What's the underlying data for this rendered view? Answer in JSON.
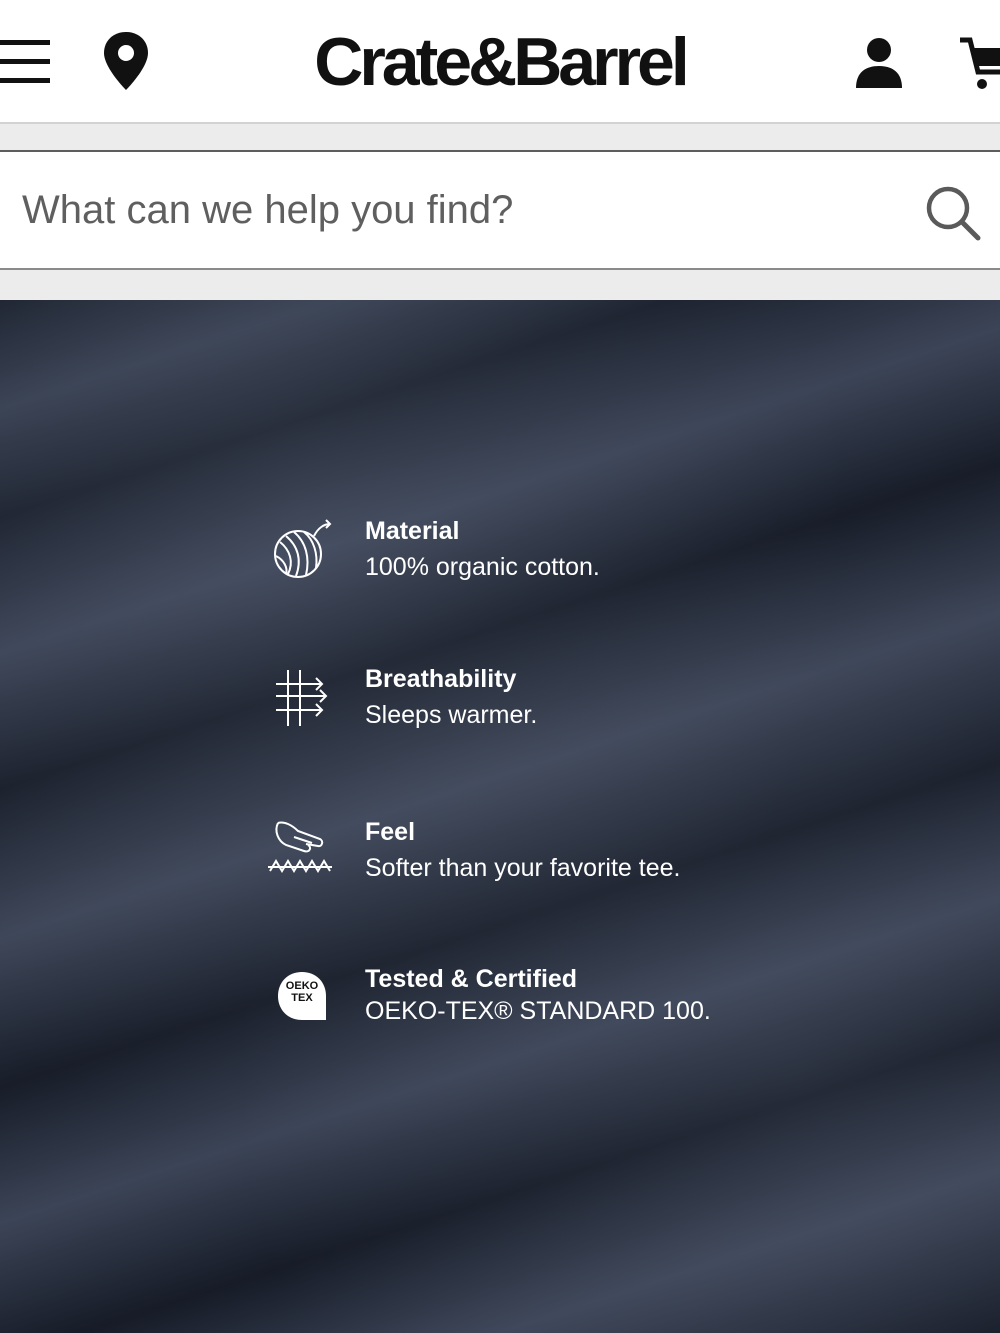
{
  "header": {
    "brand": "Crate&Barrel",
    "icons": [
      "menu-icon",
      "location-pin-icon",
      "account-icon",
      "cart-icon"
    ]
  },
  "search": {
    "placeholder": "What can we help you find?",
    "icon": "search-icon"
  },
  "features": [
    {
      "icon": "cotton-ball-icon",
      "title": "Material",
      "description": "100% organic cotton."
    },
    {
      "icon": "breathability-arrows-icon",
      "title": "Breathability",
      "description": "Sleeps warmer."
    },
    {
      "icon": "hand-feel-icon",
      "title": "Feel",
      "description": "Softer than your favorite tee."
    },
    {
      "icon": "oeko-tex-icon",
      "badge": "OEKO\nTEX",
      "title": "Tested & Certified",
      "description": "OEKO-TEX® STANDARD 100."
    }
  ],
  "colors": {
    "fabric": "#2e3646",
    "text_on_fabric": "#ffffff",
    "brand": "#111111"
  }
}
